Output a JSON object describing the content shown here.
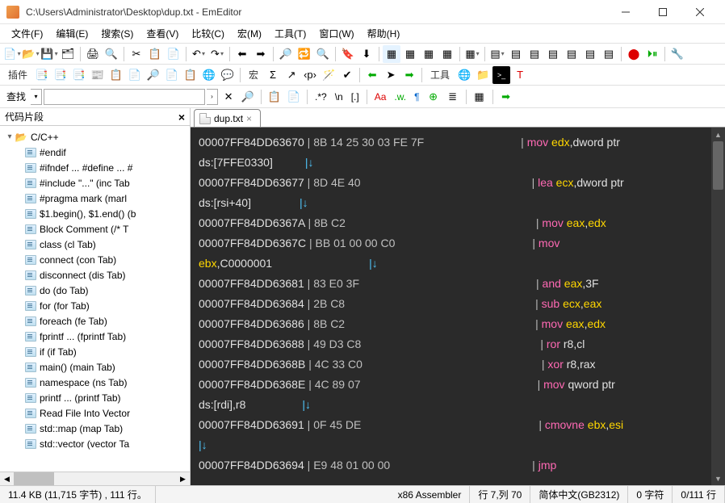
{
  "title": "C:\\Users\\Administrator\\Desktop\\dup.txt - EmEditor",
  "menu": [
    "文件(F)",
    "编辑(E)",
    "搜索(S)",
    "查看(V)",
    "比较(C)",
    "宏(M)",
    "工具(T)",
    "窗口(W)",
    "帮助(H)"
  ],
  "toolbar2_label_plugins": "插件",
  "toolbar2_label_macro": "宏",
  "toolbar2_label_tools": "工具",
  "findbar": {
    "label": "查找",
    "value": "",
    "tokens": [
      ".*?",
      "\\n",
      "[.]",
      "Aa",
      ".w.",
      "¶"
    ]
  },
  "left_panel": {
    "title": "代码片段",
    "folder": "C/C++",
    "items": [
      "#endif",
      "#ifndef ... #define ... #",
      "#include \"...\"  (inc Tab",
      "#pragma mark  (marl",
      "$1.begin(), $1.end()  (b",
      "Block Comment  (/* T",
      "class  (cl Tab)",
      "connect  (con Tab)",
      "disconnect  (dis Tab)",
      "do  (do Tab)",
      "for  (for Tab)",
      "foreach  (fe Tab)",
      "fprintf ...  (fprintf Tab)",
      "if  (if Tab)",
      "main()  (main Tab)",
      "namespace  (ns Tab)",
      "printf ...  (printf Tab)",
      "Read File Into Vector",
      "std::map  (map Tab)",
      "std::vector  (vector Ta"
    ]
  },
  "tab": "dup.txt",
  "code": {
    "l1": {
      "a": "00007FF84DD63670",
      "h": "8B 14 25 30 03 FE 7F",
      "m": "mov",
      "r1": "edx",
      "rest": ",dword ptr"
    },
    "l2": {
      "pre": "ds:[",
      "v": "7FFE0330",
      "suf": "]"
    },
    "l3": {
      "a": "00007FF84DD63677",
      "h": "8D 4E 40",
      "m": "lea",
      "r1": "ecx",
      "rest": ",dword ptr"
    },
    "l4": {
      "txt": "ds:[rsi+40]"
    },
    "l5": {
      "a": "00007FF84DD6367A",
      "h": "8B C2",
      "m": "mov",
      "r1": "eax",
      "r2": "edx"
    },
    "l6": {
      "a": "00007FF84DD6367C",
      "h": "BB 01 00 00 C0",
      "m": "mov"
    },
    "l7": {
      "r1": "ebx",
      "v": "C0000001"
    },
    "l8": {
      "a": "00007FF84DD63681",
      "h": "83 E0 3F",
      "m": "and",
      "r1": "eax",
      "v": "3F"
    },
    "l9": {
      "a": "00007FF84DD63684",
      "h": "2B C8",
      "m": "sub",
      "r1": "ecx",
      "r2": "eax"
    },
    "l10": {
      "a": "00007FF84DD63686",
      "h": "8B C2",
      "m": "mov",
      "r1": "eax",
      "r2": "edx"
    },
    "l11": {
      "a": "00007FF84DD63688",
      "h": "49 D3 C8",
      "m": "ror",
      "r2": "r8,cl"
    },
    "l12": {
      "a": "00007FF84DD6368B",
      "h": "4C 33 C0",
      "m": "xor",
      "r2": "r8,rax"
    },
    "l13": {
      "a": "00007FF84DD6368E",
      "h": "4C 89 07",
      "m": "mov",
      "rest": "qword ptr"
    },
    "l14": {
      "txt": "ds:[rdi],r8"
    },
    "l15": {
      "a": "00007FF84DD63691",
      "h": "0F 45 DE",
      "m": "cmovne",
      "r1": "ebx",
      "r2": "esi"
    },
    "l16": {
      "a": "00007FF84DD63694",
      "h": "E9 48 01 00 00",
      "m": "jmp"
    }
  },
  "status": {
    "size": "11.4 KB (11,715 字节) , 111 行。",
    "lang": "x86 Assembler",
    "pos": "行 7,列 70",
    "enc": "简体中文(GB2312)",
    "sel": "0 字符",
    "lines": "0/111 行"
  }
}
